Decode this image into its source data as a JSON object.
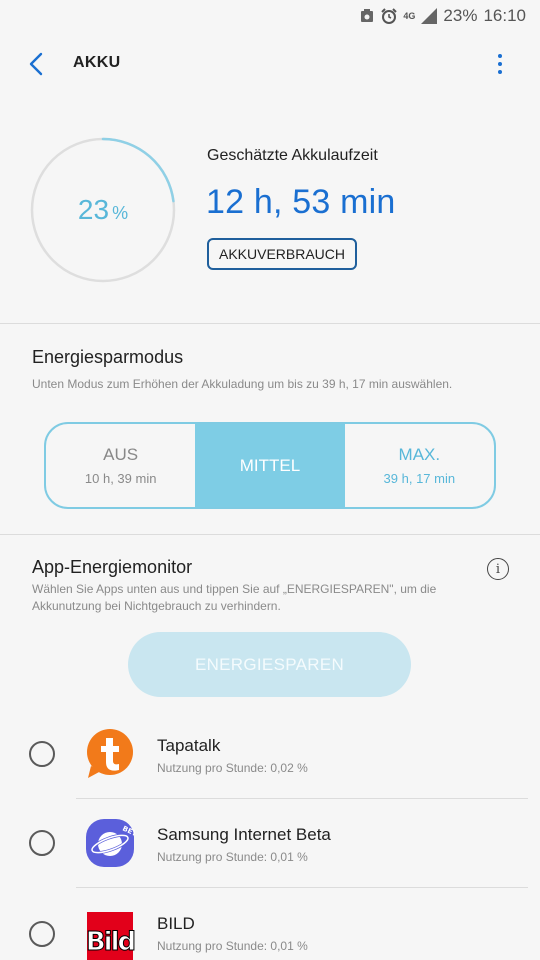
{
  "status_bar": {
    "network": "4G",
    "battery": "23%",
    "time": "16:10"
  },
  "header": {
    "title": "AKKU"
  },
  "battery": {
    "percent_number": "23",
    "percent_sign": "%",
    "charge_fraction": 0.23,
    "estimate_label": "Geschätzte Akkulaufzeit",
    "estimate_value": "12 h, 53 min",
    "usage_button": "AKKUVERBRAUCH",
    "gauge_color": "#58b7d9"
  },
  "power_saving": {
    "title": "Energiesparmodus",
    "subtitle": "Unten Modus zum Erhöhen der Akkuladung um bis zu 39 h, 17 min auswählen.",
    "options": [
      {
        "label": "AUS",
        "sub": "10 h, 39 min"
      },
      {
        "label": "MITTEL",
        "sub": ""
      },
      {
        "label": "MAX.",
        "sub": "39 h, 17 min"
      }
    ],
    "selected": "MITTEL",
    "accent_color": "#7ecde5"
  },
  "app_monitor": {
    "title": "App-Energiemonitor",
    "description": "Wählen Sie Apps unten aus und tippen Sie auf „ENERGIESPAREN\", um die Akkunutzung bei Nichtgebrauch zu verhindern.",
    "save_button": "ENERGIESPAREN",
    "apps": [
      {
        "name": "Tapatalk",
        "usage": "Nutzung pro Stunde: 0,02 %",
        "icon": "tapatalk-icon"
      },
      {
        "name": "Samsung Internet Beta",
        "usage": "Nutzung pro Stunde: 0,01 %",
        "icon": "samsung-internet-beta-icon"
      },
      {
        "name": "BILD",
        "usage": "Nutzung pro Stunde: 0,01 %",
        "icon": "bild-icon"
      }
    ]
  }
}
